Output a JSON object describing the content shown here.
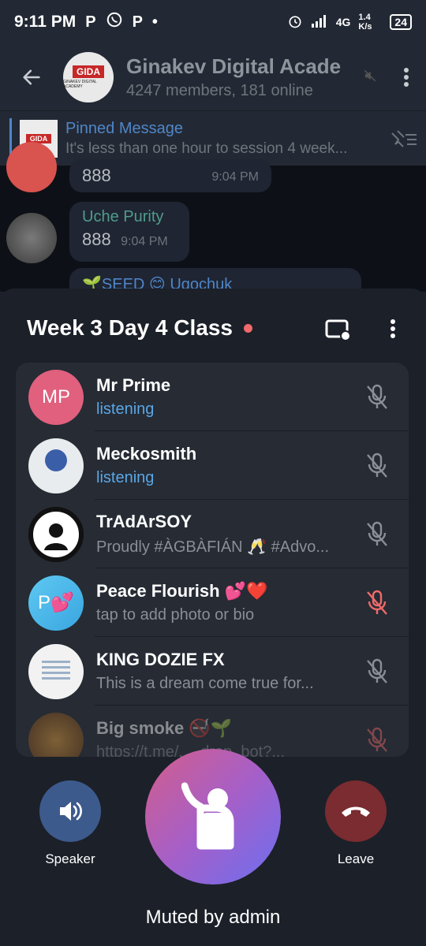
{
  "status_bar": {
    "time": "9:11 PM",
    "notification_icons": [
      "P",
      "whatsapp",
      "P",
      "•"
    ],
    "network": "4G",
    "speed": "1.4 K/s",
    "battery": "24"
  },
  "header": {
    "title": "Ginakev Digital Acade",
    "subtitle": "4247 members, 181 online",
    "avatar_badge": "GIDA",
    "avatar_sub": "GINAKEV DIGITAL ACADEMY"
  },
  "pinned": {
    "title": "Pinned Message",
    "body": "It's less than one hour to session 4 week...",
    "thumb_badge": "GIDA"
  },
  "chat": {
    "msg1_text": "888",
    "msg1_time": "9:04 PM",
    "msg2_name": "Uche Purity",
    "msg2_text": "888",
    "msg2_time": "9:04 PM",
    "msg3_preview": "🌱SEED 😊 Ugochuk"
  },
  "voice_chat": {
    "title": "Week 3 Day 4 Class",
    "participants": [
      {
        "name": "Mr Prime",
        "status": "listening",
        "initials": "MP",
        "avatar_color": "#e0607e",
        "mic": "muted"
      },
      {
        "name": "Meckosmith",
        "status": "listening",
        "initials": "",
        "avatar_color": "#cfd8dc",
        "mic": "muted"
      },
      {
        "name": "TrAdArSOY",
        "status": "Proudly #ÀGBÀFIÁN 🥂 #Advo...",
        "initials": "",
        "avatar_color": "#111111",
        "mic": "muted"
      },
      {
        "name": "Peace Flourish 💕❤️",
        "status": "tap to add photo or bio",
        "initials": "P💕",
        "avatar_color": "#4fc3f7",
        "mic": "muted-red"
      },
      {
        "name": "KING DOZIE FX",
        "status": "This is a dream come true for...",
        "initials": "",
        "avatar_color": "#f2f2f2",
        "mic": "muted"
      },
      {
        "name": "Big smoke 🚭🌱",
        "status": "https://t.me/..._drop_bot?...",
        "initials": "",
        "avatar_color": "#c98a2a",
        "mic": "muted-red"
      }
    ],
    "speaker_label": "Speaker",
    "leave_label": "Leave",
    "muted_label": "Muted by admin"
  },
  "colors": {
    "accent_blue": "#5aa7e6",
    "speaker_btn": "#3d5a8c",
    "leave_btn": "#7a2c30",
    "recording": "#f06a6a"
  }
}
